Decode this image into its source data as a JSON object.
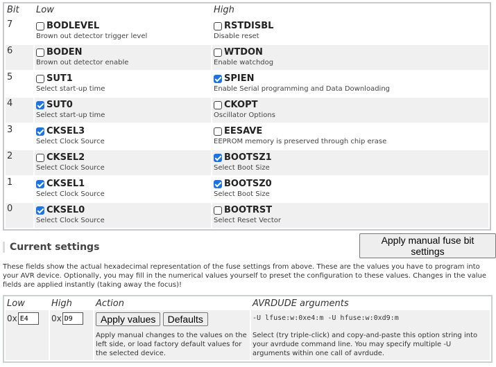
{
  "fuse_table": {
    "headers": [
      "Bit",
      "Low",
      "High"
    ],
    "rows": [
      {
        "bit": "7",
        "low": {
          "name": "BODLEVEL",
          "desc": "Brown out detector trigger level",
          "checked": false
        },
        "high": {
          "name": "RSTDISBL",
          "desc": "Disable reset",
          "checked": false
        }
      },
      {
        "bit": "6",
        "low": {
          "name": "BODEN",
          "desc": "Brown out detector enable",
          "checked": false
        },
        "high": {
          "name": "WTDON",
          "desc": "Enable watchdog",
          "checked": false
        }
      },
      {
        "bit": "5",
        "low": {
          "name": "SUT1",
          "desc": "Select start-up time",
          "checked": false
        },
        "high": {
          "name": "SPIEN",
          "desc": "Enable Serial programming and Data Downloading",
          "checked": true
        }
      },
      {
        "bit": "4",
        "low": {
          "name": "SUT0",
          "desc": "Select start-up time",
          "checked": true
        },
        "high": {
          "name": "CKOPT",
          "desc": "Oscillator Options",
          "checked": false
        }
      },
      {
        "bit": "3",
        "low": {
          "name": "CKSEL3",
          "desc": "Select Clock Source",
          "checked": true
        },
        "high": {
          "name": "EESAVE",
          "desc": "EEPROM memory is preserved through chip erase",
          "checked": false
        }
      },
      {
        "bit": "2",
        "low": {
          "name": "CKSEL2",
          "desc": "Select Clock Source",
          "checked": false
        },
        "high": {
          "name": "BOOTSZ1",
          "desc": "Select Boot Size",
          "checked": true
        }
      },
      {
        "bit": "1",
        "low": {
          "name": "CKSEL1",
          "desc": "Select Clock Source",
          "checked": true
        },
        "high": {
          "name": "BOOTSZ0",
          "desc": "Select Boot Size",
          "checked": true
        }
      },
      {
        "bit": "0",
        "low": {
          "name": "CKSEL0",
          "desc": "Select Clock Source",
          "checked": true
        },
        "high": {
          "name": "BOOTRST",
          "desc": "Select Reset Vector",
          "checked": false
        }
      }
    ]
  },
  "apply_manual_label": "Apply manual fuse bit settings",
  "current": {
    "title": "Current settings",
    "intro": "These fields show the actual hexadecimal representation of the fuse settings from above. These are the values you have to program into your AVR device. Optionally, you may fill in the numerical values yourself to preset the configuration to these values. Changes in the value fields are applied instantly (taking away the focus)!",
    "headers": [
      "Low",
      "High",
      "Action",
      "AVRDUDE arguments"
    ],
    "prefix": "0x",
    "low_value": "E4",
    "high_value": "D9",
    "apply_values_label": "Apply values",
    "defaults_label": "Defaults",
    "action_desc": "Apply manual changes to the values on the left side, or load factory default values for the selected device.",
    "avrdude_args": "-U lfuse:w:0xe4:m -U hfuse:w:0xd9:m",
    "avrdude_desc": "Select (try triple-click) and copy-and-paste this option string into your avrdude command line. You may specify multiple -U arguments within one call of avrdude."
  }
}
